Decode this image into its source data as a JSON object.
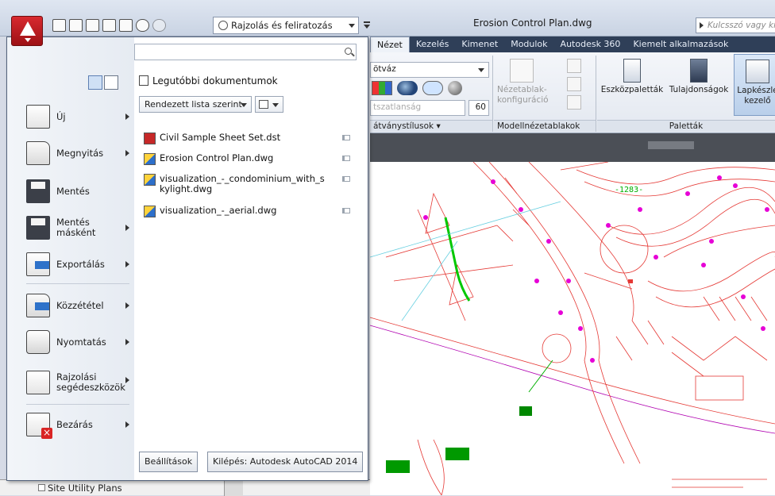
{
  "titlebar": {
    "workspace": "Rajzolás és feliratozás",
    "window_title": "Erosion Control Plan.dwg",
    "search_placeholder": "Kulcsszó vagy kif"
  },
  "ribbon": {
    "tabs": [
      "Nézet",
      "Kezelés",
      "Kimenet",
      "Modulok",
      "Autodesk 360",
      "Kiemelt alkalmazások"
    ],
    "active_tab": "Nézet",
    "visual_style_value": "ötváz",
    "transparency_label": "tszatlanság",
    "transparency_value": "60",
    "panel_visual_styles": "átványstílusok",
    "viewport_config": "Nézetablak-konfiguráció",
    "panel_model_viewports": "Modellnézetablakok",
    "tool_palettes": "Eszközpaletták",
    "properties": "Tulajdonságok",
    "sheetset_manager": "Lapkészle kezelő",
    "panel_palettes": "Paletták"
  },
  "appmenu": {
    "search_placeholder": "",
    "recent_title": "Legutóbbi dokumentumok",
    "sort_label": "Rendezett lista szerint",
    "items": [
      {
        "label": "Új",
        "icon": "new-document-icon"
      },
      {
        "label": "Megnyitás",
        "icon": "open-folder-icon"
      },
      {
        "label": "Mentés",
        "icon": "save-disk-icon"
      },
      {
        "label": "Mentés másként",
        "icon": "save-as-icon"
      },
      {
        "label": "Exportálás",
        "icon": "export-icon"
      },
      {
        "label": "Közzététel",
        "icon": "publish-icon"
      },
      {
        "label": "Nyomtatás",
        "icon": "printer-icon"
      },
      {
        "label": "Rajzolási segédeszközök",
        "icon": "drawing-utilities-icon"
      },
      {
        "label": "Bezárás",
        "icon": "close-document-icon"
      }
    ],
    "recent_files": [
      {
        "name": "Civil Sample Sheet Set.dst",
        "type": "dst"
      },
      {
        "name": "Erosion Control Plan.dwg",
        "type": "dwg"
      },
      {
        "name": "visualization_-_condominium_with_skylight.dwg",
        "type": "dwg"
      },
      {
        "name": "visualization_-_aerial.dwg",
        "type": "dwg"
      }
    ],
    "options_button": "Beállítások",
    "exit_button": "Kilépés: Autodesk AutoCAD 2014"
  },
  "drawing": {
    "label": "-1283-"
  },
  "palette": {
    "item": "Site Utility Plans"
  },
  "colors": {
    "app_button": "#c4161c",
    "drawing_lines": "#e53935",
    "markers": "#e600d6",
    "accent_green": "#00c800"
  }
}
